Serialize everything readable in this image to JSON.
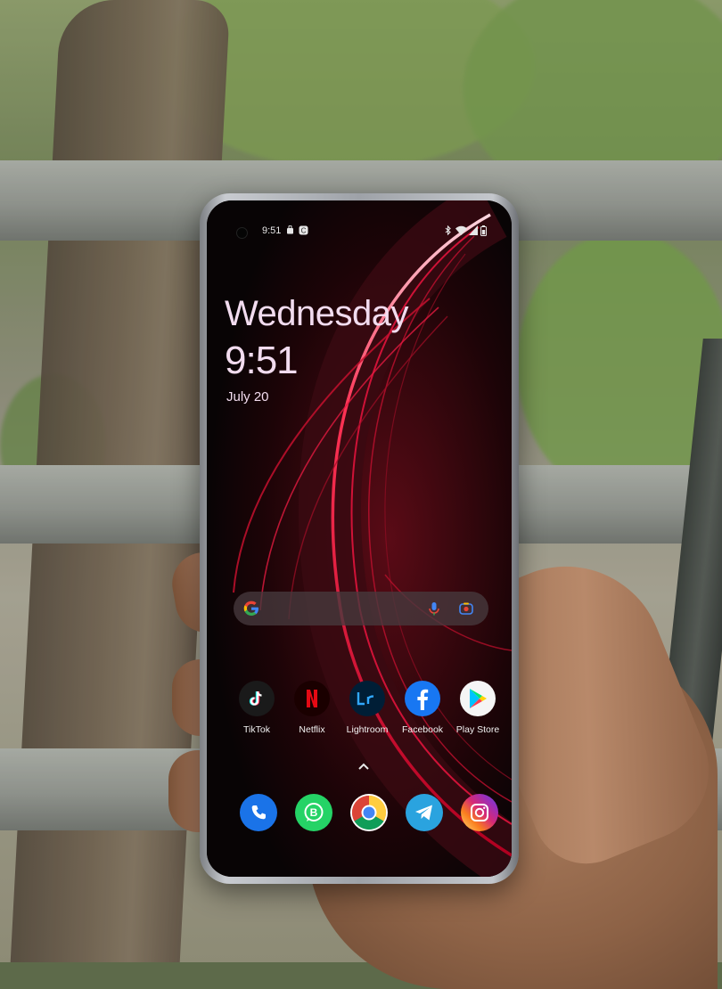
{
  "status_bar": {
    "time": "9:51",
    "left_icons": [
      "bag-icon",
      "app-badge-icon"
    ],
    "right_icons": [
      "bluetooth-icon",
      "wifi-icon",
      "signal-icon",
      "battery-icon"
    ]
  },
  "lock_clock": {
    "day": "Wednesday",
    "time": "9:51",
    "date": "July 20"
  },
  "search_bar": {
    "logo": "G",
    "icons": [
      "google-logo-icon",
      "mic-icon",
      "lens-icon"
    ]
  },
  "apps": [
    {
      "label": "TikTok",
      "icon": "tiktok-icon",
      "color": "#1a1a1a"
    },
    {
      "label": "Netflix",
      "icon": "netflix-icon",
      "color": "#1a0000"
    },
    {
      "label": "Lightroom",
      "icon": "lightroom-icon",
      "color": "#001e36"
    },
    {
      "label": "Facebook",
      "icon": "facebook-icon",
      "color": "#1877f2"
    },
    {
      "label": "Play Store",
      "icon": "play-store-icon",
      "color": "#f5f5f5"
    }
  ],
  "dock": [
    {
      "icon": "phone-icon",
      "color": "#1a73e8"
    },
    {
      "icon": "whatsapp-business-icon",
      "color": "#25d366"
    },
    {
      "icon": "chrome-icon",
      "color": "#ffffff"
    },
    {
      "icon": "telegram-icon",
      "color": "#2aa3df"
    },
    {
      "icon": "instagram-icon",
      "color": "#d62976"
    }
  ],
  "app_drawer_hint": "chevron-up-icon",
  "accent_colors": {
    "wallpaper_red": "#e0143c",
    "clock_text": "#f2dcef"
  }
}
